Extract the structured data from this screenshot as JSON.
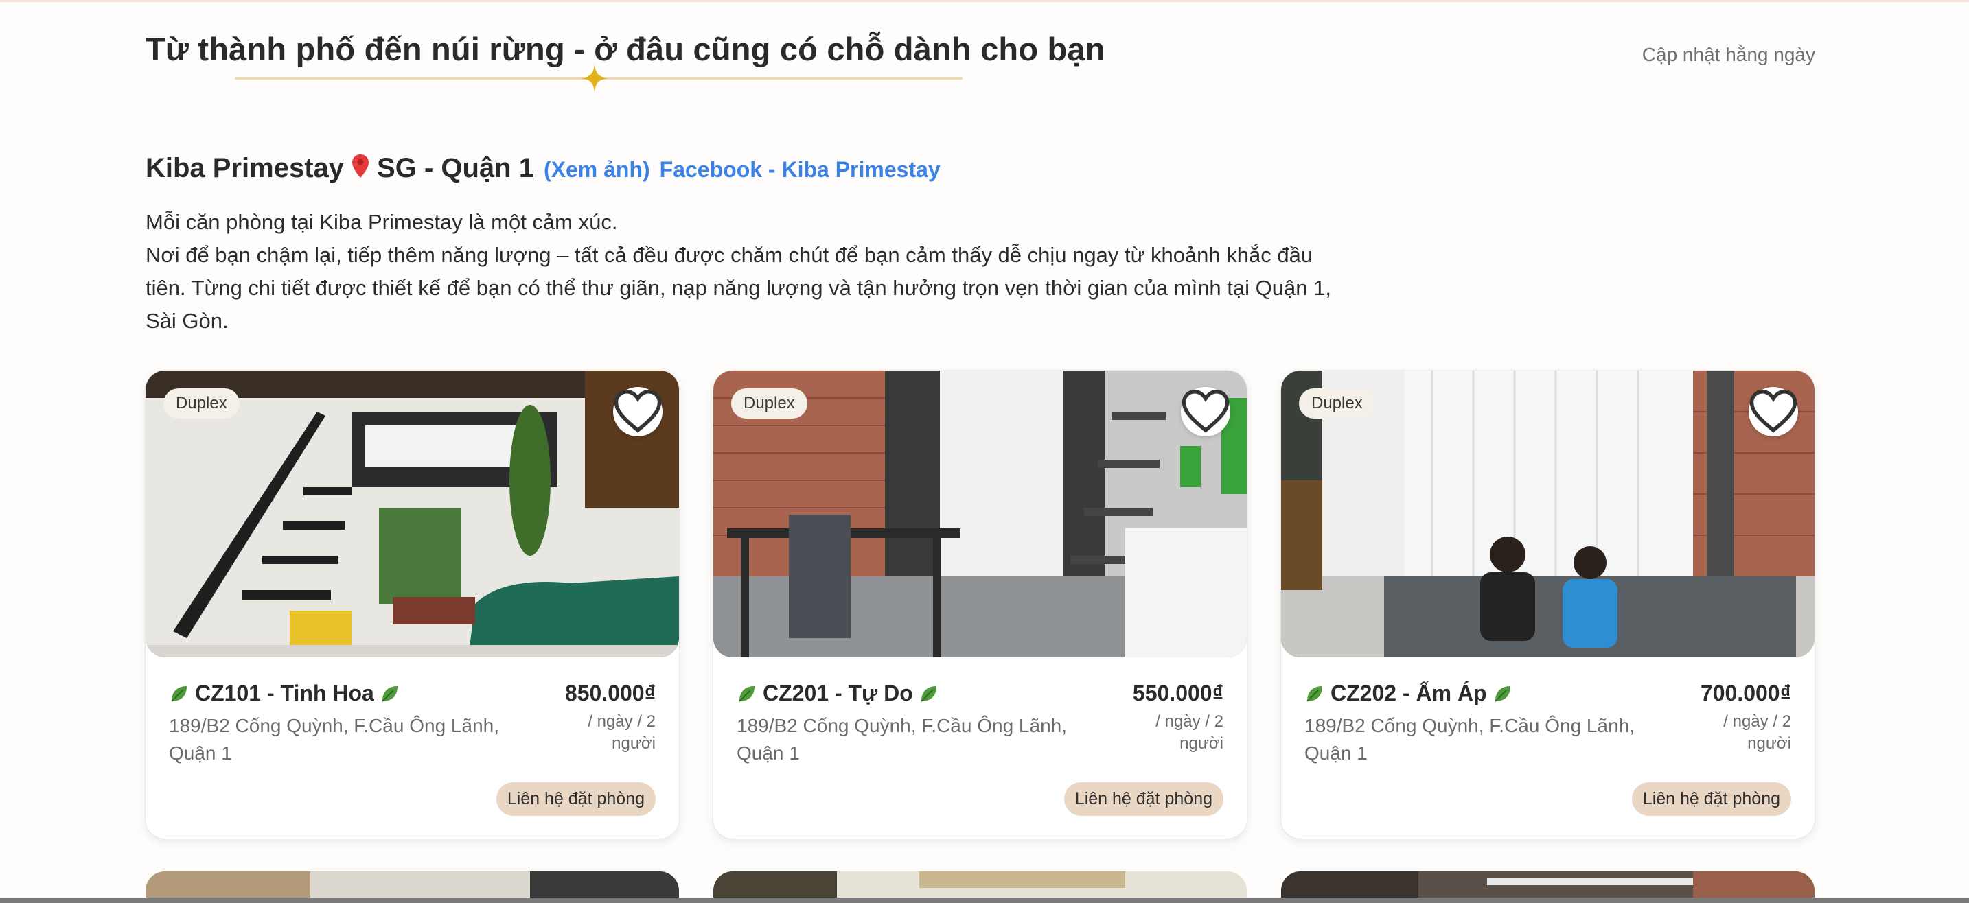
{
  "header": {
    "title": "Từ thành phố đến núi rừng - ở đâu cũng có chỗ dành cho bạn",
    "update_note": "Cập nhật hằng ngày"
  },
  "venue": {
    "name": "Kiba Primestay",
    "pin_icon": "map-pin-icon",
    "area": "SG - Quận 1",
    "photos_link": "(Xem ảnh)",
    "facebook_link": "Facebook - Kiba Primestay",
    "description": "Mỗi căn phòng tại Kiba Primestay là một cảm xúc.\nNơi để bạn chậm lại, tiếp thêm năng lượng – tất cả đều được chăm chút để bạn cảm thấy dễ chịu ngay từ khoảnh khắc đầu tiên. Từng chi tiết được thiết kế để bạn có thể thư giãn, nạp năng lượng và tận hưởng trọn vẹn thời gian của mình tại Quận 1, Sài Gòn."
  },
  "rooms": [
    {
      "badge": "Duplex",
      "name": "CZ101 - Tinh Hoa",
      "address": "189/B2 Cống Quỳnh, F.Cầu Ông Lãnh, Quận 1",
      "price": "850.000₫",
      "price_unit": "/ ngày / 2 người",
      "contact": "Liên hệ đặt phòng"
    },
    {
      "badge": "Duplex",
      "name": "CZ201 - Tự Do",
      "address": "189/B2 Cống Quỳnh, F.Cầu Ông Lãnh, Quận 1",
      "price": "550.000₫",
      "price_unit": "/ ngày / 2 người",
      "contact": "Liên hệ đặt phòng"
    },
    {
      "badge": "Duplex",
      "name": "CZ202 - Ấm Áp",
      "address": "189/B2 Cống Quỳnh, F.Cầu Ông Lãnh, Quận 1",
      "price": "700.000₫",
      "price_unit": "/ ngày / 2 người",
      "contact": "Liên hệ đặt phòng"
    }
  ],
  "colors": {
    "accent_link": "#3b82e6",
    "button_bg": "#ead7c3",
    "divider": "#ecd9b8",
    "sparkle": "#e2b21d",
    "leaf": "#4f9a3a"
  }
}
